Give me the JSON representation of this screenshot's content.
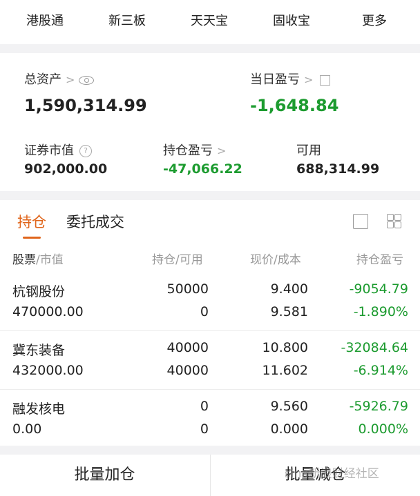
{
  "shortcuts": [
    {
      "label": "港股通"
    },
    {
      "label": "新三板"
    },
    {
      "label": "天天宝"
    },
    {
      "label": "固收宝"
    },
    {
      "label": "更多"
    }
  ],
  "assets": {
    "total_label": "总资产",
    "total_value": "1,590,314.99",
    "daily_pl_label": "当日盈亏",
    "daily_pl_value": "-1,648.84",
    "securities_label": "证券市值",
    "securities_value": "902,000.00",
    "position_pl_label": "持仓盈亏",
    "position_pl_value": "-47,066.22",
    "available_label": "可用",
    "available_value": "688,314.99"
  },
  "tabs": [
    {
      "label": "持仓",
      "active": true
    },
    {
      "label": "委托成交",
      "active": false
    }
  ],
  "columns": [
    {
      "main": "股票",
      "sub": "/市值"
    },
    {
      "main": "持仓",
      "sub": "/可用"
    },
    {
      "main": "现价",
      "sub": "/成本"
    },
    {
      "main": "持仓盈亏",
      "sub": ""
    }
  ],
  "holdings": [
    {
      "name": "杭钢股份",
      "market_value": "470000.00",
      "position": "50000",
      "available": "0",
      "price": "9.400",
      "cost": "9.581",
      "pl": "-9054.79",
      "pl_pct": "-1.890%"
    },
    {
      "name": "冀东装备",
      "market_value": "432000.00",
      "position": "40000",
      "available": "40000",
      "price": "10.800",
      "cost": "11.602",
      "pl": "-32084.64",
      "pl_pct": "-6.914%"
    },
    {
      "name": "融发核电",
      "market_value": "0.00",
      "position": "0",
      "available": "0",
      "price": "9.560",
      "cost": "0.000",
      "pl": "-5926.79",
      "pl_pct": "0.000%"
    }
  ],
  "actions": {
    "batch_add": "批量加仓",
    "batch_reduce": "批量减仓"
  },
  "watermark": "sina新浪财经社区",
  "colors": {
    "accent": "#e0651b",
    "loss": "#1c9b2f"
  }
}
